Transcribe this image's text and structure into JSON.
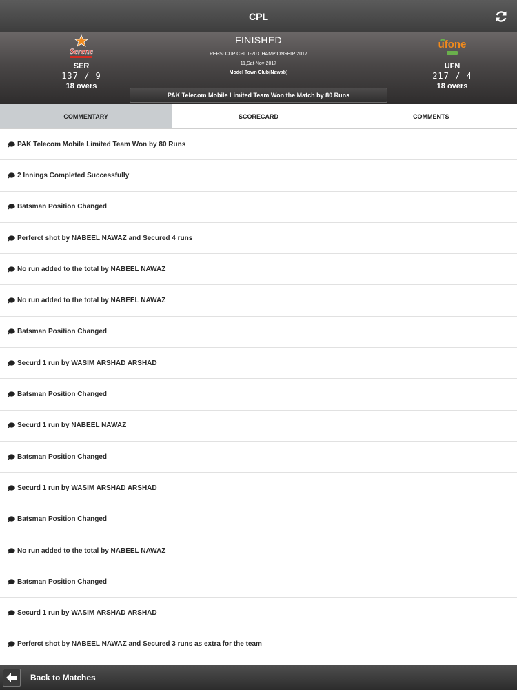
{
  "header": {
    "title": "CPL",
    "refresh_icon": "refresh-icon"
  },
  "match": {
    "status": "FINISHED",
    "tournament": "PEPSI CUP CPL T-20 CHAMPIONSHIP 2017",
    "date": "11,Sat-Nov-2017",
    "venue": "Model Town Club(Nawab)",
    "result": "PAK Telecom Mobile Limited Team Won the Match by 80 Runs",
    "team_left": {
      "logo_text": "Serene",
      "code": "SER",
      "score": "137 / 9",
      "overs": "18 overs"
    },
    "team_right": {
      "logo_text": "ufone",
      "code": "UFN",
      "score": "217 / 4",
      "overs": "18 overs"
    }
  },
  "tabs": [
    {
      "label": "COMMENTARY",
      "active": true
    },
    {
      "label": "SCORECARD",
      "active": false
    },
    {
      "label": "COMMENTS",
      "active": false
    }
  ],
  "commentary": [
    "PAK Telecom Mobile Limited Team Won by 80 Runs",
    "2 Innings Completed Successfully",
    "Batsman Position Changed",
    "Perferct shot by NABEEL NAWAZ and Secured 4 runs",
    "No run added to the total by NABEEL NAWAZ",
    "No run added to the total by NABEEL NAWAZ",
    "Batsman Position Changed",
    "Securd 1 run by WASIM ARSHAD ARSHAD",
    "Batsman Position Changed",
    "Securd 1 run by NABEEL NAWAZ",
    "Batsman Position Changed",
    "Securd 1 run by WASIM ARSHAD ARSHAD",
    "Batsman Position Changed",
    "No run added to the total by NABEEL NAWAZ",
    "Batsman Position Changed",
    "Securd 1 run by WASIM ARSHAD ARSHAD",
    "Perferct shot by NABEEL NAWAZ and Secured 3 runs as extra for the team"
  ],
  "footer": {
    "back_label": "Back to Matches",
    "back_icon": "arrow-left-icon"
  },
  "colors": {
    "active_tab": "#c9cdd0",
    "header_dark": "#3d3d3d",
    "logo_red": "#d12d22",
    "logo_orange": "#f08a1c",
    "logo_green": "#6ab04c"
  }
}
